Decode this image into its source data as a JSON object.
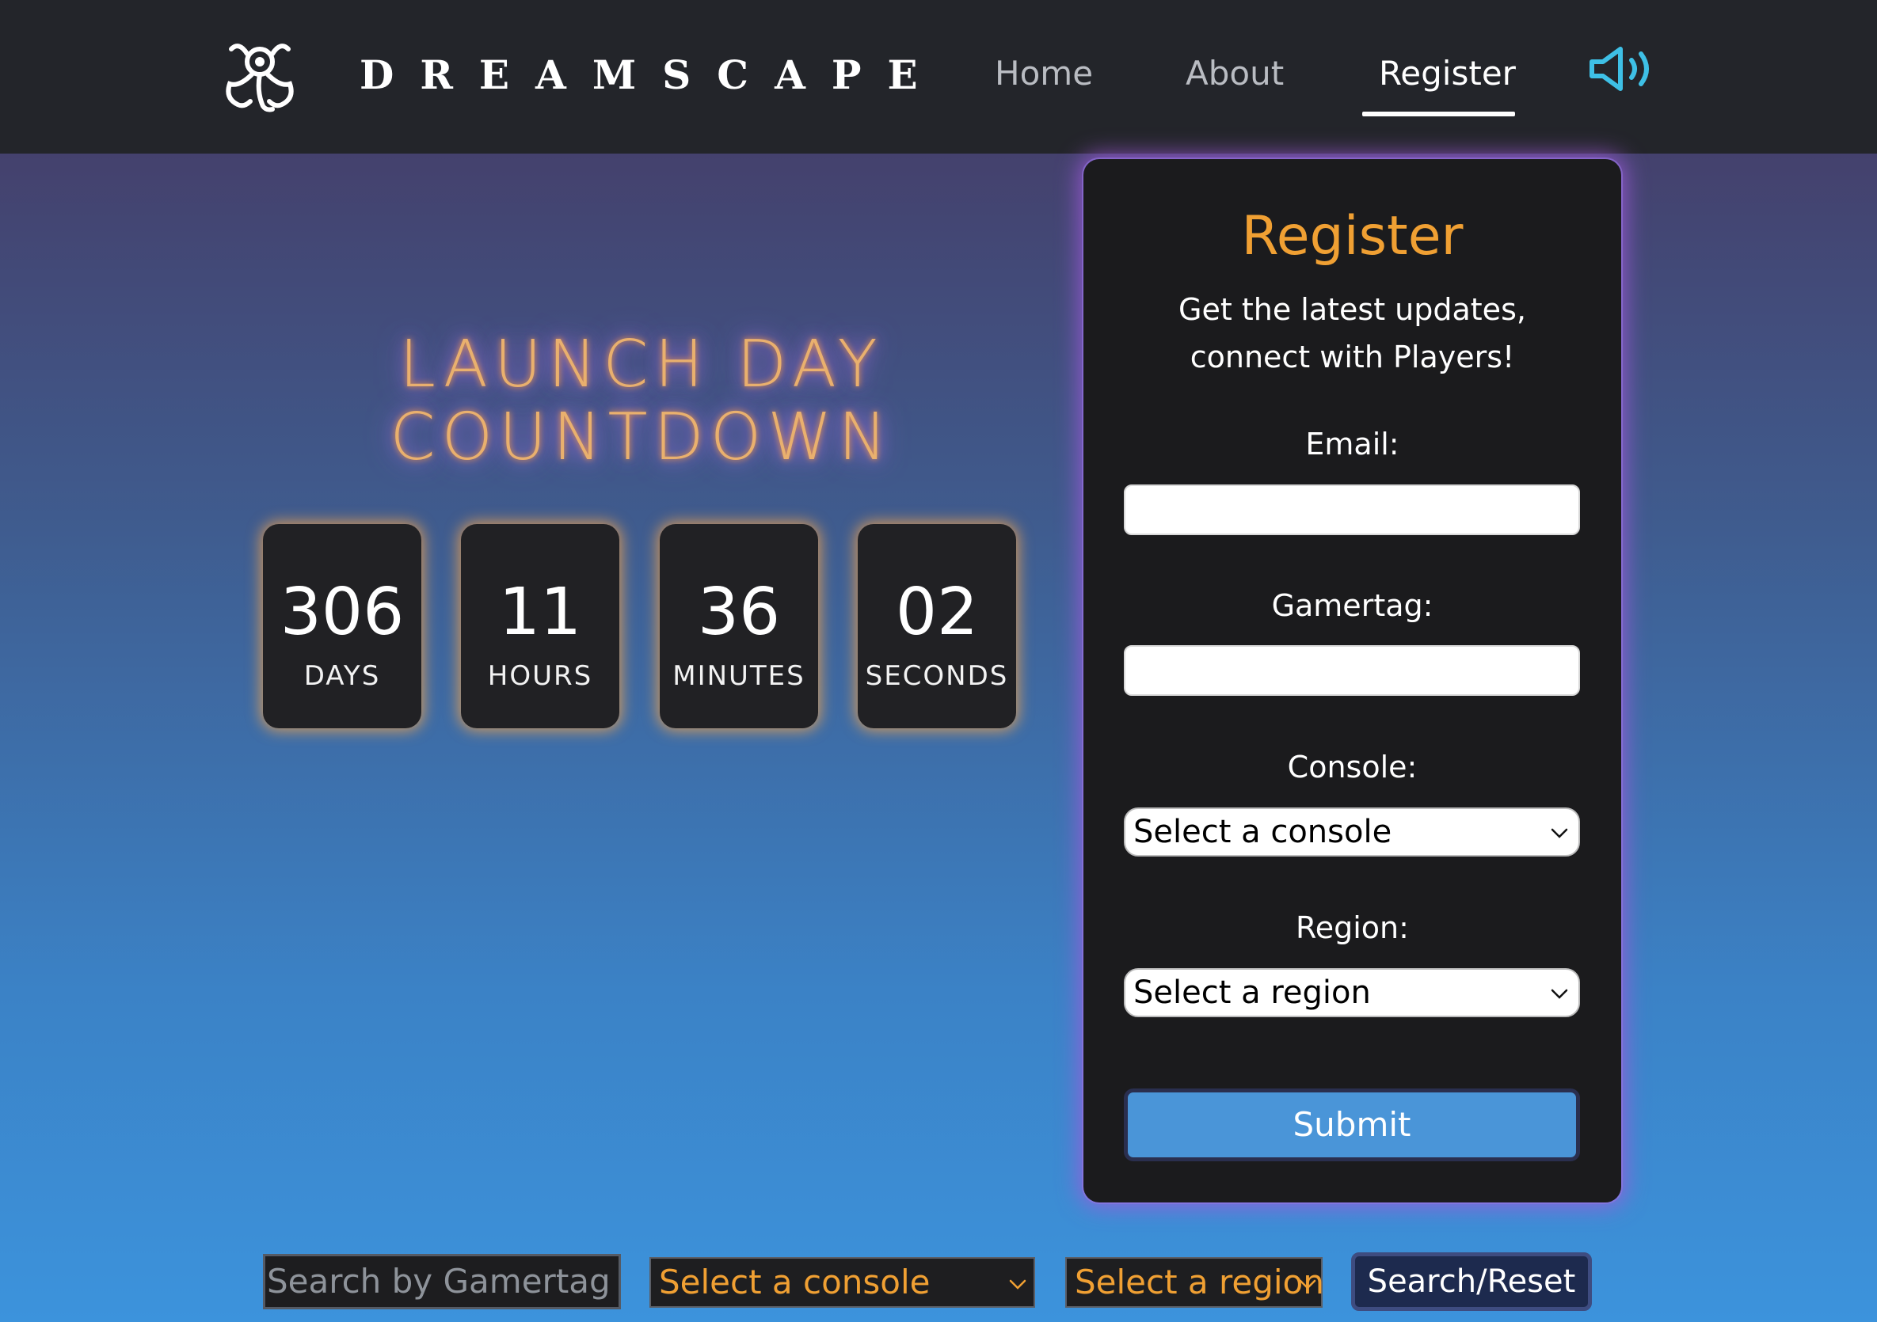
{
  "header": {
    "brand": "DREAMSCAPE",
    "logo_icon": "dreamscape-emblem-icon",
    "nav": [
      {
        "label": "Home",
        "active": false
      },
      {
        "label": "About",
        "active": false
      },
      {
        "label": "Register",
        "active": true
      }
    ],
    "sound_icon": "speaker-volume-icon"
  },
  "countdown": {
    "title_line1": "LAUNCH DAY",
    "title_line2": "COUNTDOWN",
    "units": [
      {
        "value": "306",
        "label": "DAYS"
      },
      {
        "value": "11",
        "label": "HOURS"
      },
      {
        "value": "36",
        "label": "MINUTES"
      },
      {
        "value": "02",
        "label": "SECONDS"
      }
    ]
  },
  "register": {
    "title": "Register",
    "subtitle_line1": "Get the latest updates,",
    "subtitle_line2": "connect with Players!",
    "email_label": "Email:",
    "email_value": "",
    "gamertag_label": "Gamertag:",
    "gamertag_value": "",
    "console_label": "Console:",
    "console_selected": "Select a console",
    "region_label": "Region:",
    "region_selected": "Select a region",
    "submit_label": "Submit"
  },
  "search": {
    "gamertag_placeholder": "Search by Gamertag",
    "console_selected": "Select a console",
    "region_selected": "Select a region",
    "button_label": "Search/Reset"
  },
  "colors": {
    "header_bg": "#23252a",
    "accent_orange": "#f0a033",
    "button_blue": "#4a95d8",
    "card_bg": "#1b1b1d",
    "glow_purple": "#a271e0"
  }
}
